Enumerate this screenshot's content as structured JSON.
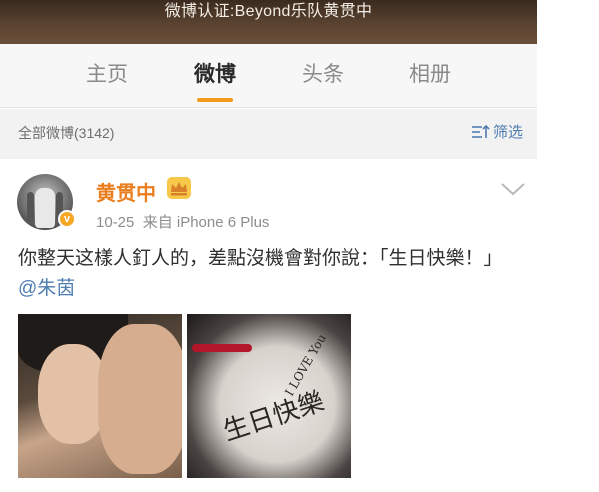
{
  "banner": {
    "text": "微博认证:Beyond乐队黄贯中"
  },
  "tabs": [
    {
      "label": "主页",
      "active": false
    },
    {
      "label": "微博",
      "active": true
    },
    {
      "label": "头条",
      "active": false
    },
    {
      "label": "相册",
      "active": false
    }
  ],
  "filter": {
    "all_label": "全部微博(3142)",
    "button_label": "筛选"
  },
  "post": {
    "username": "黄贯中",
    "meta": "10-25  来自 iPhone 6 Plus",
    "text_main": "你整天这樣人釘人的，差點沒機會對你說：「生日快樂！」",
    "mention": "@朱茵",
    "photo2_text_cn": "生日快樂",
    "photo2_text_en": "I LOVE You"
  },
  "colors": {
    "accent_orange": "#f29a1c",
    "username_orange": "#eb7d1c",
    "link_blue": "#4f7cb1"
  },
  "icons": {
    "filter": "filter-icon",
    "chevron": "chevron-down-icon",
    "crown": "crown-icon",
    "verified": "verified-badge-icon"
  }
}
